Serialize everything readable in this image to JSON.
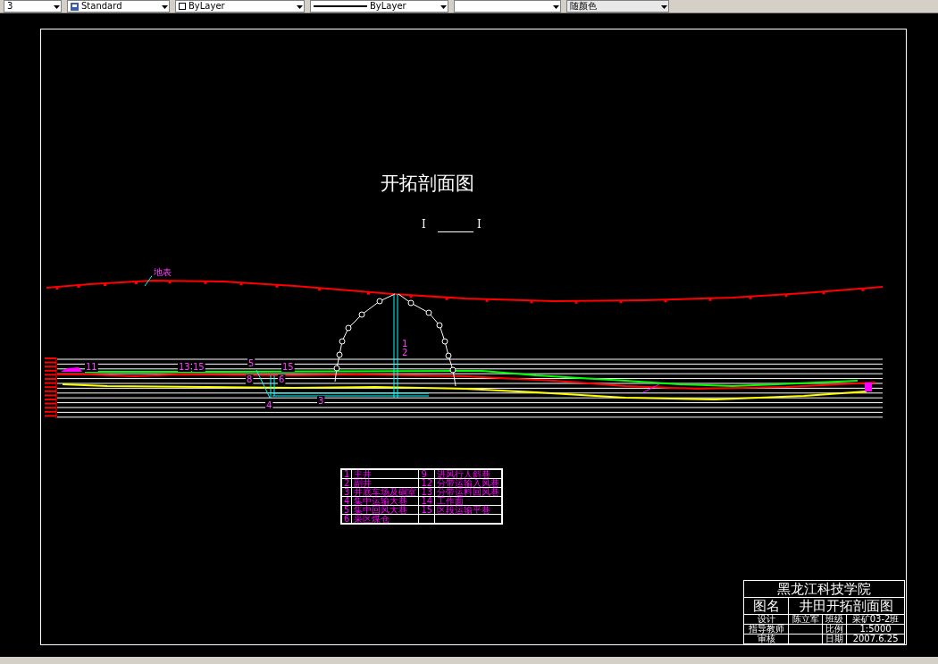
{
  "toolbar": {
    "dropdowns": [
      {
        "kind": "plain",
        "value": "3"
      },
      {
        "kind": "style",
        "value": "Standard"
      },
      {
        "kind": "layer",
        "value": "ByLayer"
      },
      {
        "kind": "linetype",
        "value": "ByLayer"
      },
      {
        "kind": "plain"
      },
      {
        "kind": "color",
        "value": "随颜色"
      }
    ]
  },
  "drawing": {
    "title": "开拓剖面图",
    "section": {
      "left": "I",
      "right": "I"
    },
    "labels": [
      "地表",
      "1",
      "2",
      "3",
      "4",
      "5",
      "6",
      "8",
      "11",
      "13",
      "15",
      "15"
    ],
    "legend": [
      {
        "num": "1",
        "name": "主井",
        "num2": "9",
        "name2": "进风行人斜巷"
      },
      {
        "num": "2",
        "name": "副井",
        "num2": "12",
        "name2": "分带运输入风巷"
      },
      {
        "num": "3",
        "name": "井底车场及硐室",
        "num2": "13",
        "name2": "分带运料回风巷"
      },
      {
        "num": "4",
        "name": "集中运输大巷",
        "num2": "14",
        "name2": "工作面"
      },
      {
        "num": "5",
        "name": "集中回风大巷",
        "num2": "15",
        "name2": "区段运输平巷"
      },
      {
        "num": "6",
        "name": "采区煤仓"
      }
    ],
    "title_block": {
      "school": "黑龙江科技学院",
      "name_label": "图名",
      "name": "井田开拓剖面图",
      "rows": [
        [
          "设计",
          "陈立军",
          "班级",
          "采矿03-2班"
        ],
        [
          "指导教师",
          "",
          "比例",
          "1:5000"
        ],
        [
          "审核",
          "",
          "日期",
          "2007.6.25"
        ]
      ]
    }
  }
}
